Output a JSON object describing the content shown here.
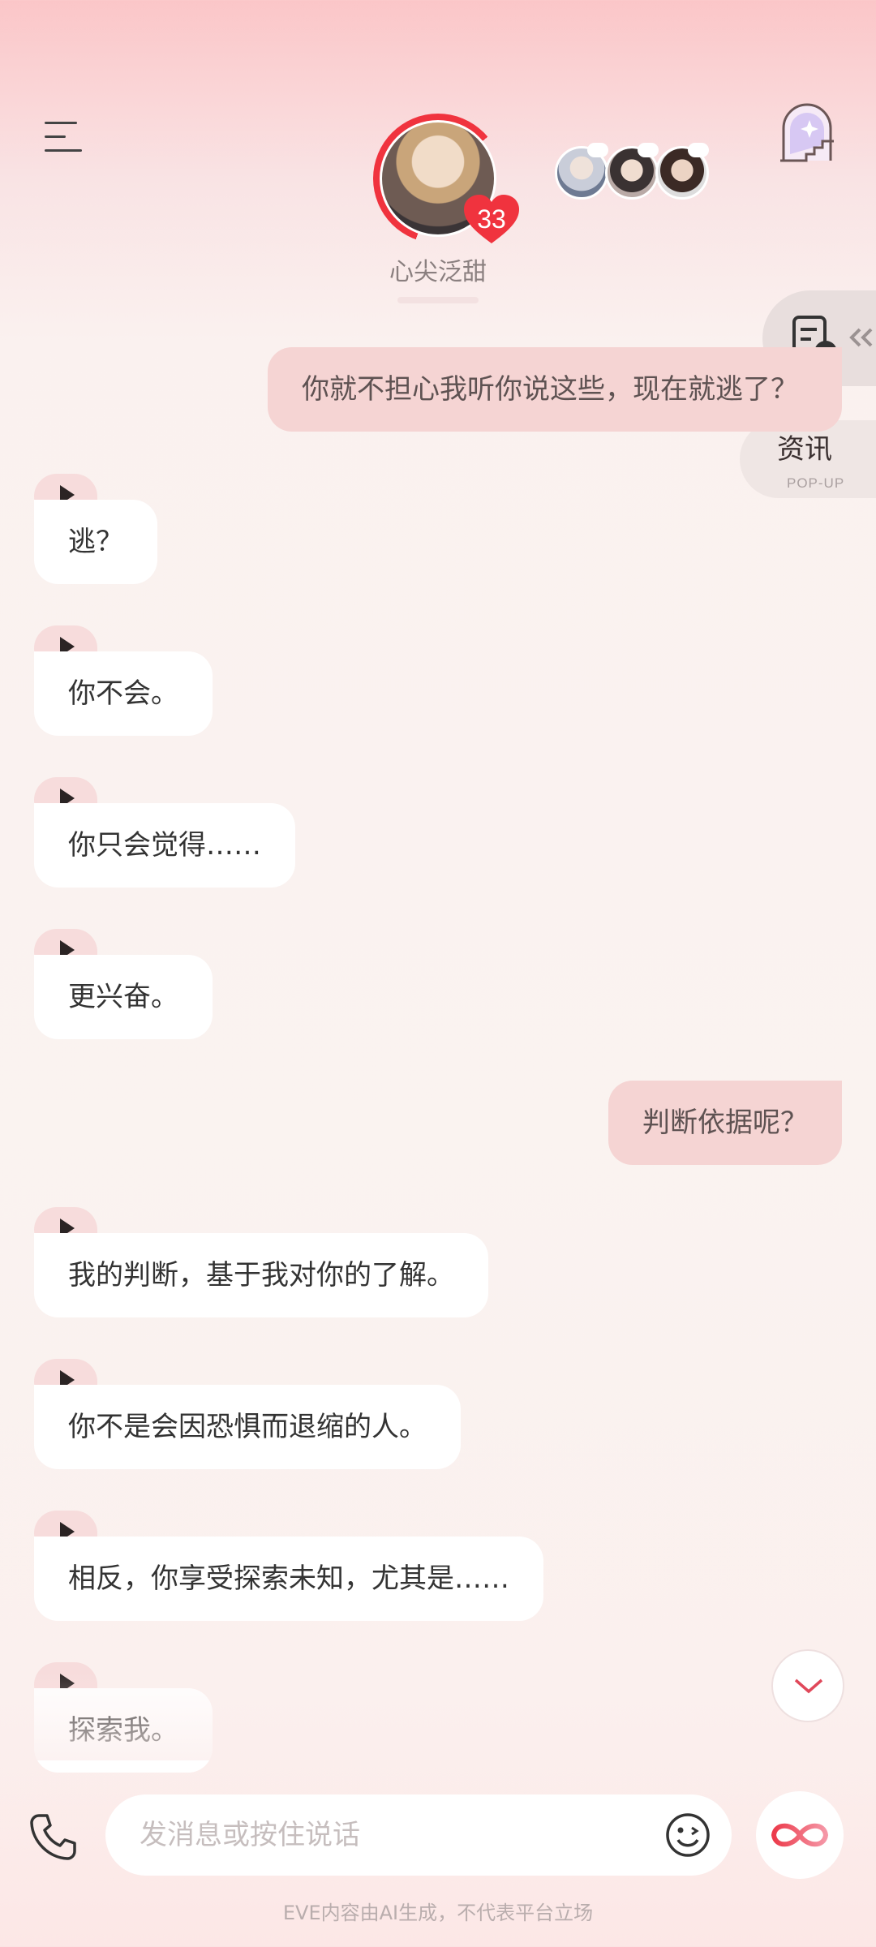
{
  "header": {
    "character_name": "心尖泛甜",
    "affinity_count": "33"
  },
  "side_panel": {
    "news_label": "资讯",
    "news_sub": "POP-UP"
  },
  "messages": [
    {
      "side": "right",
      "text": "你就不担心我听你说这些，现在就逃了？"
    },
    {
      "side": "left",
      "text": "逃？"
    },
    {
      "side": "left",
      "text": "你不会。"
    },
    {
      "side": "left",
      "text": "你只会觉得……"
    },
    {
      "side": "left",
      "text": "更兴奋。"
    },
    {
      "side": "right",
      "text": "判断依据呢？"
    },
    {
      "side": "left",
      "text": "我的判断，基于我对你的了解。"
    },
    {
      "side": "left",
      "text": "你不是会因恐惧而退缩的人。"
    },
    {
      "side": "left",
      "text": "相反，你享受探索未知，尤其是……"
    },
    {
      "side": "left",
      "text": "探索我。"
    }
  ],
  "input": {
    "placeholder": "发消息或按住说话"
  },
  "footer": {
    "disclaimer": "EVE内容由AI生成，不代表平台立场"
  },
  "colors": {
    "accent": "#f0333e",
    "user_bubble": "#f5d4d3",
    "bot_bubble": "#ffffff"
  },
  "icons": [
    "menu-icon",
    "heart-icon",
    "portal-icon",
    "checklist-icon",
    "play-icon",
    "chevron-down-icon",
    "phone-icon",
    "emoji-icon",
    "infinity-icon"
  ]
}
